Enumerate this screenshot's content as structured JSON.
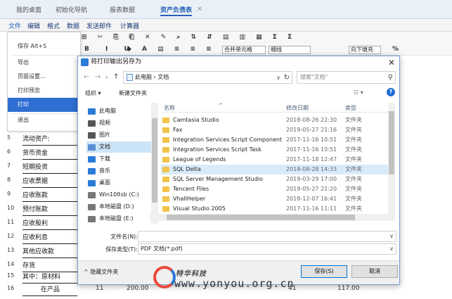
{
  "tabs": [
    {
      "label": "我的桌面"
    },
    {
      "label": "初始化导航"
    },
    {
      "label": "报表数据"
    },
    {
      "label": "资产负债表"
    }
  ],
  "menubar": [
    "文件",
    "编辑",
    "格式",
    "数据",
    "发送邮件",
    "计算器"
  ],
  "toolbar": {
    "row1": "B I U",
    "merge_label": "合并单元格",
    "border_label": "细线",
    "wrap_label": "向下填充",
    "percent": "%"
  },
  "file_menu": [
    {
      "label": "保存 Alt+S"
    },
    {
      "label": "导出"
    },
    {
      "label": "页面设置..."
    },
    {
      "label": "打印预览"
    },
    {
      "label": "打印"
    },
    {
      "label": "退出"
    }
  ],
  "sheet_rows": [
    {
      "num": "5",
      "label": "流动资产:"
    },
    {
      "num": "6",
      "label": "货币资金"
    },
    {
      "num": "7",
      "label": "短期投资"
    },
    {
      "num": "8",
      "label": "应收票据"
    },
    {
      "num": "9",
      "label": "应收账款"
    },
    {
      "num": "10",
      "label": "预付账款"
    },
    {
      "num": "11",
      "label": "应收股利"
    },
    {
      "num": "12",
      "label": "应收利息"
    },
    {
      "num": "13",
      "label": "其他应收款"
    },
    {
      "num": "14",
      "label": "存货"
    },
    {
      "num": "15",
      "label": "其中：原材料"
    },
    {
      "num": "16",
      "label": "在产品"
    }
  ],
  "bottom_cells": {
    "c1": "11",
    "c2": "200.00",
    "c3": "41",
    "c4": "117.00"
  },
  "dialog": {
    "title": "将打印输出另存为",
    "path": "此电脑 › 文档",
    "search_placeholder": "搜索\"文档\"",
    "organize": "组织 ▾",
    "new_folder": "新建文件夹",
    "nav_items": [
      {
        "label": "此电脑",
        "icon": "computer-icon",
        "color": "#2a7bd8"
      },
      {
        "label": "视频",
        "icon": "video-icon",
        "color": "#555"
      },
      {
        "label": "图片",
        "icon": "picture-icon",
        "color": "#555"
      },
      {
        "label": "文档",
        "icon": "document-icon",
        "color": "#5b8fd6",
        "selected": true
      },
      {
        "label": "下载",
        "icon": "download-icon",
        "color": "#2a7bd8"
      },
      {
        "label": "音乐",
        "icon": "music-icon",
        "color": "#2a7bd8"
      },
      {
        "label": "桌面",
        "icon": "desktop-icon",
        "color": "#2a7bd8"
      },
      {
        "label": "Win10ltsb (C:)",
        "icon": "drive-icon",
        "color": "#777"
      },
      {
        "label": "本地磁盘 (D:)",
        "icon": "drive-icon",
        "color": "#777"
      },
      {
        "label": "本地磁盘 (E:)",
        "icon": "drive-icon",
        "color": "#777"
      }
    ],
    "columns": {
      "name": "名称",
      "date": "修改日期",
      "type": "类型"
    },
    "files": [
      {
        "name": "Camtasia Studio",
        "date": "2018-08-26 22:30",
        "type": "文件夹"
      },
      {
        "name": "Fax",
        "date": "2019-05-27 21:16",
        "type": "文件夹"
      },
      {
        "name": "Integration Services Script Component",
        "date": "2017-11-16 10:51",
        "type": "文件夹"
      },
      {
        "name": "Integration Services Script Task",
        "date": "2017-11-16 10:51",
        "type": "文件夹"
      },
      {
        "name": "League of Legends",
        "date": "2017-11-18 12:47",
        "type": "文件夹"
      },
      {
        "name": "SQL Delta",
        "date": "2018-08-28 14:33",
        "type": "文件夹",
        "selected": true
      },
      {
        "name": "SQL Server Management Studio",
        "date": "2019-03-29 17:00",
        "type": "文件夹"
      },
      {
        "name": "Tencent Files",
        "date": "2019-05-27 21:20",
        "type": "文件夹"
      },
      {
        "name": "VhallHelper",
        "date": "2018-12-07 16:41",
        "type": "文件夹"
      },
      {
        "name": "Visual Studio 2005",
        "date": "2017-11-16 11:11",
        "type": "文件夹"
      }
    ],
    "filename_label": "文件名(N):",
    "filename_value": "",
    "savetype_label": "保存类型(T):",
    "savetype_value": "PDF 文档(*.pdf)",
    "hide_folders": "^ 隐藏文件夹",
    "save_button": "保存(S)",
    "cancel_button": "取消"
  },
  "watermark": {
    "cn": "特华科技",
    "url": "www.yonyou.org.cn"
  },
  "colors": {
    "accent": "#2f6fd3",
    "tab_active": "#2a62b7",
    "folder": "#f2c44b",
    "selection": "#d9ebfa"
  }
}
